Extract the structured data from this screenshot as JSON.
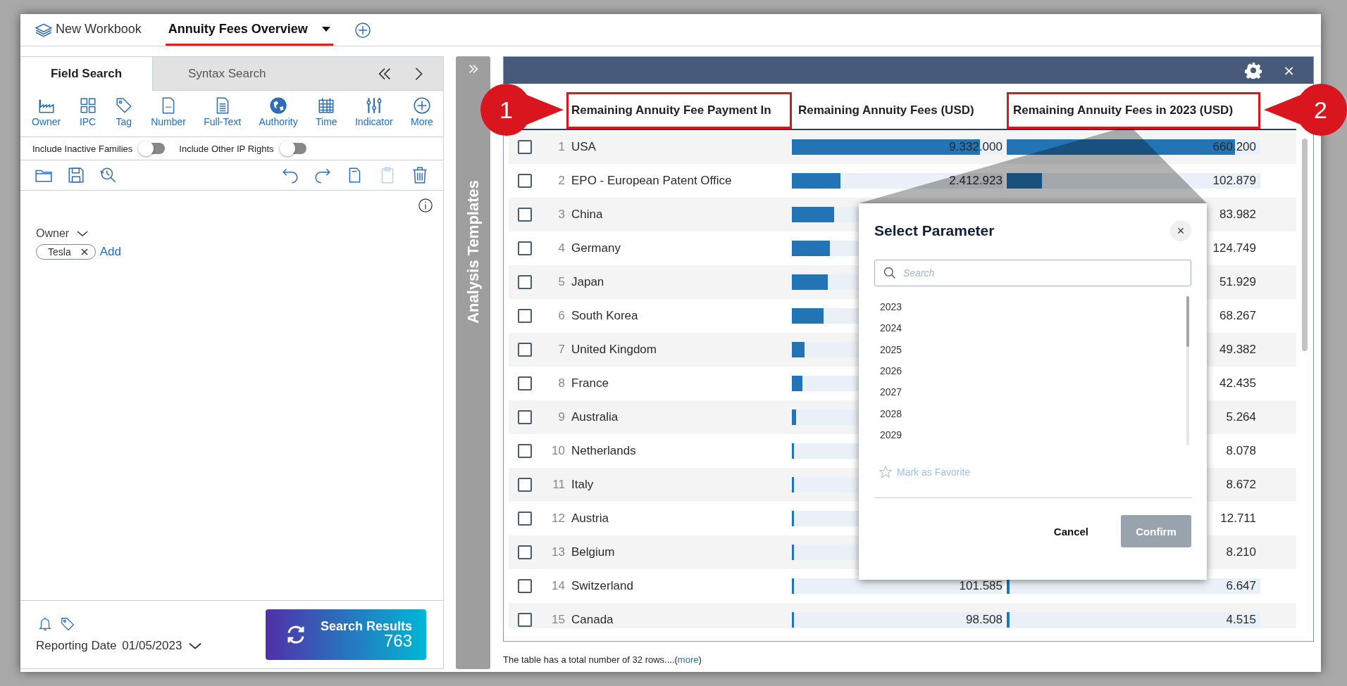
{
  "workbook_tabs": [
    {
      "label": "New Workbook",
      "selected": false,
      "kind": "workbook"
    },
    {
      "label": "Annuity Fees Overview",
      "selected": true,
      "kind": "sheet"
    }
  ],
  "search_panel": {
    "tabs": [
      {
        "label": "Field Search",
        "selected": true
      },
      {
        "label": "Syntax Search",
        "selected": false
      }
    ],
    "fields": [
      "Owner",
      "IPC",
      "Tag",
      "Number",
      "Full-Text",
      "Authority",
      "Time",
      "Indicator",
      "More"
    ],
    "toggles": [
      {
        "label": "Include Inactive Families",
        "on": false
      },
      {
        "label": "Include Other IP Rights",
        "on": false
      }
    ],
    "owner_filter": {
      "label": "Owner",
      "chips": [
        "Tesla"
      ],
      "add_link": "Add"
    },
    "reporting_date": {
      "label": "Reporting Date",
      "value": "01/05/2023"
    },
    "search_button": {
      "label": "Search Results",
      "count": "763"
    }
  },
  "side_bar": {
    "title": "Analysis Templates"
  },
  "panel_close": "×",
  "table": {
    "columns": [
      {
        "label": "Remaining Annuity Fee Payment In",
        "highlighted": true
      },
      {
        "label": "Remaining Annuity Fees (USD)",
        "highlighted": false
      },
      {
        "label": "Remaining Annuity Fees in 2023 (USD)",
        "highlighted": true
      }
    ],
    "rows": [
      {
        "index": "1",
        "name": "USA",
        "checked": false,
        "fees": {
          "level": 0.89,
          "value": "9.332.000"
        },
        "fees_2023": {
          "level": 0.9,
          "value": "660.200"
        }
      },
      {
        "index": "2",
        "name": "EPO - European Patent Office",
        "checked": false,
        "fees": {
          "level": 0.23,
          "value": "2.412.923"
        },
        "fees_2023": {
          "level": 0.14,
          "value": "102.879"
        }
      },
      {
        "index": "3",
        "name": "China",
        "checked": false,
        "fees": {
          "level": 0.2
        },
        "fees_2023": {
          "value": "83.982"
        }
      },
      {
        "index": "4",
        "name": "Germany",
        "checked": false,
        "fees": {
          "level": 0.18
        },
        "fees_2023": {
          "value": "124.749"
        }
      },
      {
        "index": "5",
        "name": "Japan",
        "checked": false,
        "fees": {
          "level": 0.17
        },
        "fees_2023": {
          "value": "51.929"
        }
      },
      {
        "index": "6",
        "name": "South Korea",
        "checked": false,
        "fees": {
          "level": 0.15
        },
        "fees_2023": {
          "value": "68.267"
        }
      },
      {
        "index": "7",
        "name": "United Kingdom",
        "checked": false,
        "fees": {
          "level": 0.06
        },
        "fees_2023": {
          "value": "49.382"
        }
      },
      {
        "index": "8",
        "name": "France",
        "checked": false,
        "fees": {
          "level": 0.05
        },
        "fees_2023": {
          "value": "42.435"
        }
      },
      {
        "index": "9",
        "name": "Australia",
        "checked": false,
        "fees": {
          "level": 0.02
        },
        "fees_2023": {
          "value": "5.264"
        }
      },
      {
        "index": "10",
        "name": "Netherlands",
        "checked": false,
        "fees": {
          "level": 0.01
        },
        "fees_2023": {
          "value": "8.078"
        }
      },
      {
        "index": "11",
        "name": "Italy",
        "checked": false,
        "fees": {
          "level": 0.01
        },
        "fees_2023": {
          "value": "8.672"
        }
      },
      {
        "index": "12",
        "name": "Austria",
        "checked": false,
        "fees": {
          "level": 0.01
        },
        "fees_2023": {
          "value": "12.711"
        }
      },
      {
        "index": "13",
        "name": "Belgium",
        "checked": false,
        "fees": {
          "level": 0.01
        },
        "fees_2023": {
          "value": "8.210"
        }
      },
      {
        "index": "14",
        "name": "Switzerland",
        "checked": false,
        "fees": {
          "level": 0.01,
          "value": "101.585"
        },
        "fees_2023": {
          "level": 0.01,
          "value": "6.647"
        }
      },
      {
        "index": "15",
        "name": "Canada",
        "checked": false,
        "fees": {
          "level": 0.01,
          "value": "98.508"
        },
        "fees_2023": {
          "level": 0.01,
          "value": "4.515"
        }
      }
    ],
    "footer": {
      "text": "The table has a total number of 32 rows....(",
      "link": "more",
      "text_after": ")"
    }
  },
  "annotations": [
    {
      "label": "1"
    },
    {
      "label": "2"
    }
  ],
  "dialog": {
    "title": "Select Parameter",
    "close": "×",
    "search": {
      "placeholder": "Search"
    },
    "options": [
      "2023",
      "2024",
      "2025",
      "2026",
      "2027",
      "2028",
      "2029"
    ],
    "favorite": {
      "label": "Mark as Favorite",
      "disabled": true
    },
    "buttons": [
      {
        "label": "Cancel",
        "kind": "text"
      },
      {
        "label": "Confirm",
        "kind": "primary",
        "disabled": true
      }
    ]
  }
}
